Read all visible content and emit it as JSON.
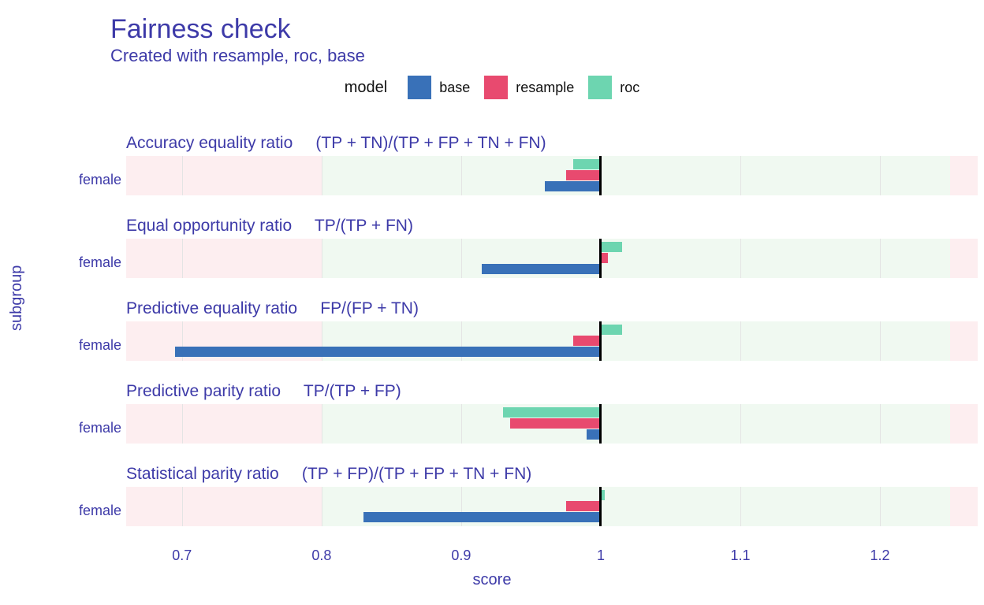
{
  "title": "Fairness check",
  "subtitle": "Created with resample, roc, base",
  "legend_title": "model",
  "legend_items": [
    {
      "key": "base",
      "label": "base"
    },
    {
      "key": "resample",
      "label": "resample"
    },
    {
      "key": "roc",
      "label": "roc"
    }
  ],
  "ylabel": "subgroup",
  "xlabel": "score",
  "ytick": "female",
  "xticks": [
    "0.7",
    "0.8",
    "0.9",
    "1",
    "1.1",
    "1.2"
  ],
  "chart_data": {
    "type": "bar",
    "xlim": [
      0.66,
      1.27
    ],
    "ref": 1.0,
    "fair_zone": [
      0.8,
      1.25
    ],
    "facets": [
      {
        "title": "Accuracy equality ratio     (TP + TN)/(TP + FP + TN + FN)",
        "category": "female",
        "series": [
          {
            "name": "roc",
            "value": 0.98
          },
          {
            "name": "resample",
            "value": 0.975
          },
          {
            "name": "base",
            "value": 0.96
          }
        ]
      },
      {
        "title": "Equal opportunity ratio     TP/(TP + FN)",
        "category": "female",
        "series": [
          {
            "name": "roc",
            "value": 1.015
          },
          {
            "name": "resample",
            "value": 1.005
          },
          {
            "name": "base",
            "value": 0.915
          }
        ]
      },
      {
        "title": "Predictive equality ratio     FP/(FP + TN)",
        "category": "female",
        "series": [
          {
            "name": "roc",
            "value": 1.015
          },
          {
            "name": "resample",
            "value": 0.98
          },
          {
            "name": "base",
            "value": 0.695
          }
        ]
      },
      {
        "title": "Predictive parity ratio     TP/(TP + FP)",
        "category": "female",
        "series": [
          {
            "name": "roc",
            "value": 0.93
          },
          {
            "name": "resample",
            "value": 0.935
          },
          {
            "name": "base",
            "value": 0.99
          }
        ]
      },
      {
        "title": "Statistical parity ratio     (TP + FP)/(TP + FP + TN + FN)",
        "category": "female",
        "series": [
          {
            "name": "roc",
            "value": 1.003
          },
          {
            "name": "resample",
            "value": 0.975
          },
          {
            "name": "base",
            "value": 0.83
          }
        ]
      }
    ]
  }
}
